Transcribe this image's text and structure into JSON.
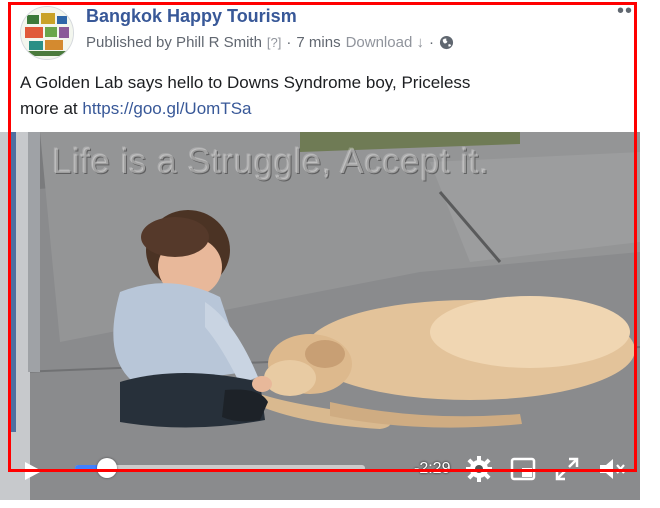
{
  "post": {
    "page_name": "Bangkok Happy Tourism",
    "published_by": "Published by Phill R Smith",
    "help_marker": "[?]",
    "separator": "·",
    "time_ago": "7 mins",
    "download_label": "Download ↓",
    "caption_text": "A Golden Lab says hello to Downs Syndrome boy, Priceless",
    "more_at": "more at ",
    "link_text": "https://goo.gl/UomTSa",
    "more_icon": "more-options-dots"
  },
  "video": {
    "overlay_text": "Life is a Struggle, Accept it.",
    "time_remaining": "-2:29",
    "progress": 0.11,
    "icons": [
      "play-icon",
      "settings-icon",
      "picture-in-picture-icon",
      "fullscreen-icon",
      "muted-volume-icon"
    ]
  },
  "colors": {
    "link": "#385898",
    "progress": "#4080ff",
    "highlight_box": "#ff0000"
  }
}
